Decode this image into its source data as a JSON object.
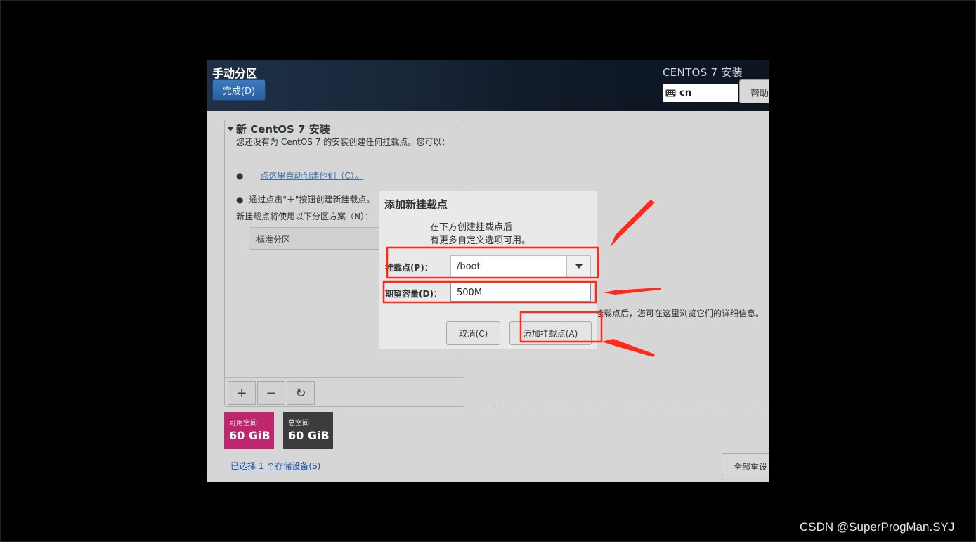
{
  "header": {
    "title": "手动分区",
    "done_button": "完成(D)",
    "product": "CENTOS 7 安装",
    "keyboard_layout": "cn",
    "help_button": "帮助"
  },
  "left_panel": {
    "section_title": "新 CentOS 7 安装",
    "description": "您还没有为 CentOS 7 的安装创建任何挂载点。您可以：",
    "auto_create_link": "点这里自动创建他们（C）。",
    "manual_hint": "通过点击\"＋\"按钮创建新挂载点。",
    "scheme_label": "新挂载点将使用以下分区方案（N）：",
    "scheme_value": "标准分区",
    "toolbar": {
      "add": "+",
      "remove": "−",
      "refresh": "↻"
    }
  },
  "space": {
    "available_label": "可用空间",
    "available_value": "60 GiB",
    "total_label": "总空间",
    "total_value": "60 GiB",
    "available_color": "#c0266d",
    "total_color": "#3c3c3c"
  },
  "storage_link": "已选择 1 个存储设备(S)",
  "right_info": "挂载点后，您可在这里浏览它们的详细信息。",
  "reset_button": "全部重设",
  "dialog": {
    "title": "添加新挂载点",
    "message_line1": "在下方创建挂载点后",
    "message_line2": "有更多自定义选项可用。",
    "mount_point_label": "挂载点(P)：",
    "mount_point_value": "/boot",
    "capacity_label": "期望容量(D)：",
    "capacity_value": "500M",
    "cancel_button": "取消(C)",
    "add_button": "添加挂载点(A)"
  },
  "annotation_color": "#ff2a1a",
  "watermark": "CSDN @SuperProgMan.SYJ"
}
